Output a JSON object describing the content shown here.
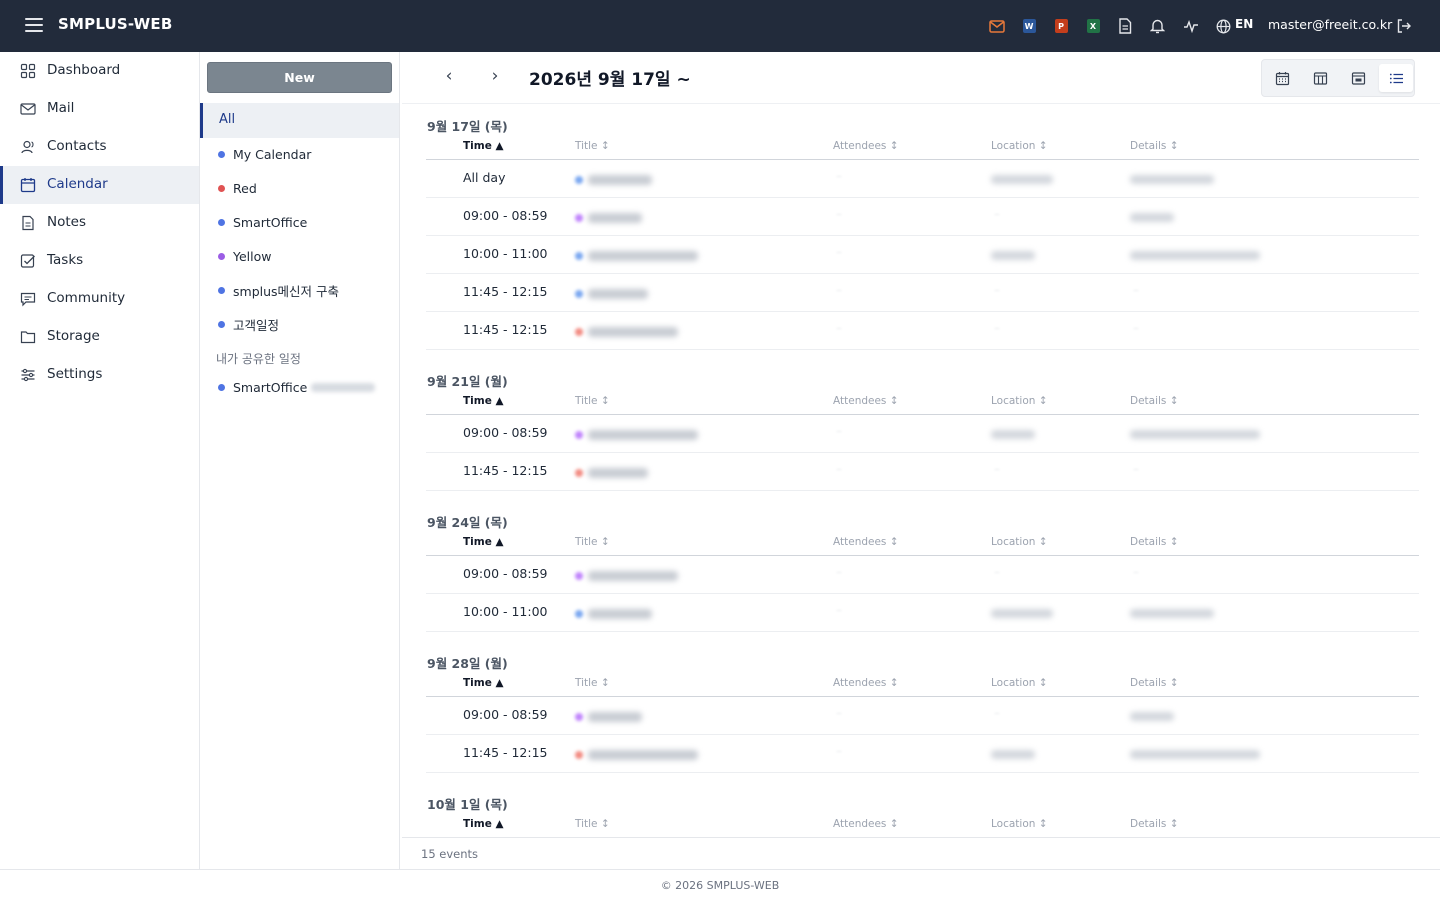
{
  "app": {
    "brand": "SMPLUS-WEB"
  },
  "topbar": {
    "lang": "EN",
    "user_email": "master@freeit.co.kr",
    "icons": [
      "mail-icon",
      "word-icon",
      "powerpoint-icon",
      "excel-icon",
      "document-icon",
      "bell-icon",
      "activity-icon",
      "globe-icon",
      "logout-icon"
    ],
    "doc_badges": {
      "word": "W",
      "powerpoint": "P",
      "excel": "X"
    },
    "colors": {
      "bg": "#222b3b",
      "mail": "#e8793a",
      "word": "#2b579a",
      "powerpoint": "#c43e1c",
      "excel": "#217346"
    }
  },
  "sidebar": {
    "items": [
      {
        "label": "Dashboard",
        "icon": "dashboard-icon"
      },
      {
        "label": "Mail",
        "icon": "mail-icon"
      },
      {
        "label": "Contacts",
        "icon": "contacts-icon"
      },
      {
        "label": "Calendar",
        "icon": "calendar-icon",
        "active": true
      },
      {
        "label": "Notes",
        "icon": "notes-icon"
      },
      {
        "label": "Tasks",
        "icon": "tasks-icon"
      },
      {
        "label": "Community",
        "icon": "community-icon"
      },
      {
        "label": "Storage",
        "icon": "folder-icon"
      },
      {
        "label": "Settings",
        "icon": "settings-icon"
      }
    ]
  },
  "calendars": {
    "new_label": "New",
    "all_label": "All",
    "items": [
      {
        "name": "My Calendar",
        "color": "#4f74e3"
      },
      {
        "name": "Red",
        "color": "#e05353"
      },
      {
        "name": "SmartOffice",
        "color": "#4f74e3"
      },
      {
        "name": "Yellow",
        "color": "#9b5de5"
      },
      {
        "name": "smplus메신저 구축",
        "color": "#4f74e3"
      },
      {
        "name": "고객일정",
        "color": "#4f74e3"
      }
    ],
    "shared_section_label": "내가 공유한 일정",
    "shared_items": [
      {
        "name": "SmartOffice",
        "color": "#4f74e3"
      }
    ]
  },
  "main": {
    "prev_label": "‹",
    "next_label": "›",
    "date_title": "2026년 9월 17일 ~",
    "views": [
      "month-view-icon",
      "week-view-icon",
      "day-view-icon",
      "list-view-icon"
    ],
    "active_view": "list-view-icon",
    "columns": {
      "time": "Time ▲",
      "title": "Title ↕",
      "attendees": "Attendees ↕",
      "location": "Location ↕",
      "details": "Details ↕"
    },
    "groups": [
      {
        "date": "9월 17일 (목)",
        "rows": [
          {
            "time": "All day",
            "dot": "#7aa7f0"
          },
          {
            "time": "09:00 - 08:59",
            "dot": "#c084fc"
          },
          {
            "time": "10:00 - 11:00",
            "dot": "#7aa7f0"
          },
          {
            "time": "11:45 - 12:15",
            "dot": "#7aa7f0"
          },
          {
            "time": "11:45 - 12:15",
            "dot": "#f28b82"
          }
        ]
      },
      {
        "date": "9월 21일 (월)",
        "rows": [
          {
            "time": "09:00 - 08:59",
            "dot": "#c084fc"
          },
          {
            "time": "11:45 - 12:15",
            "dot": "#f28b82"
          }
        ]
      },
      {
        "date": "9월 24일 (목)",
        "rows": [
          {
            "time": "09:00 - 08:59",
            "dot": "#c084fc"
          },
          {
            "time": "10:00 - 11:00",
            "dot": "#7aa7f0"
          }
        ]
      },
      {
        "date": "9월 28일 (월)",
        "rows": [
          {
            "time": "09:00 - 08:59",
            "dot": "#c084fc"
          },
          {
            "time": "11:45 - 12:15",
            "dot": "#f28b82"
          }
        ]
      },
      {
        "date": "10월 1일 (목)",
        "rows": []
      }
    ],
    "event_count": "15 events"
  },
  "footer": {
    "copyright": "© 2026 SMPLUS-WEB"
  }
}
